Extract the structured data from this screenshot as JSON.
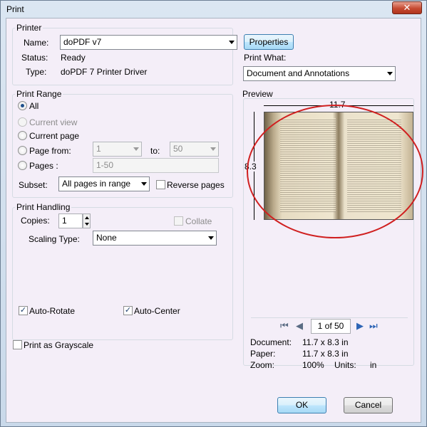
{
  "window": {
    "title": "Print",
    "close_glyph": "✕"
  },
  "printer": {
    "group_label": "Printer",
    "name_label": "Name:",
    "name_value": "doPDF v7",
    "status_label": "Status:",
    "status_value": "Ready",
    "type_label": "Type:",
    "type_value": "doPDF 7 Printer Driver",
    "properties_button": "Properties",
    "print_what_label": "Print What:",
    "print_what_value": "Document and Annotations"
  },
  "print_range": {
    "group_label": "Print Range",
    "all_label": "All",
    "current_view_label": "Current view",
    "current_page_label": "Current page",
    "pages_from_label": "Page from:",
    "from_value": "1",
    "to_label": "to:",
    "to_value": "50",
    "pages_label": "Pages :",
    "pages_value": "1-50",
    "subset_label": "Subset:",
    "subset_value": "All pages in range",
    "reverse_label": "Reverse pages"
  },
  "print_handling": {
    "group_label": "Print Handling",
    "copies_label": "Copies:",
    "copies_value": "1",
    "collate_label": "Collate",
    "scaling_label": "Scaling Type:",
    "scaling_value": "None",
    "auto_rotate_label": "Auto-Rotate",
    "auto_center_label": "Auto-Center"
  },
  "grayscale_label": "Print as Grayscale",
  "preview": {
    "label": "Preview",
    "width_dim": "11.7",
    "height_dim": "8.3",
    "page_indicator": "1 of 50",
    "document_label": "Document:",
    "document_value": "11.7 x 8.3 in",
    "paper_label": "Paper:",
    "paper_value": "11.7 x 8.3 in",
    "zoom_label": "Zoom:",
    "zoom_value": "100%",
    "units_label": "Units:",
    "units_value": "in"
  },
  "buttons": {
    "ok": "OK",
    "cancel": "Cancel"
  },
  "icons": {
    "first_page": "first-page-icon",
    "prev_page": "previous-page-icon",
    "next_page": "next-page-icon",
    "last_page": "last-page-icon"
  },
  "colors": {
    "accent": "#2d64b5",
    "annotation_ring": "#d02020"
  }
}
